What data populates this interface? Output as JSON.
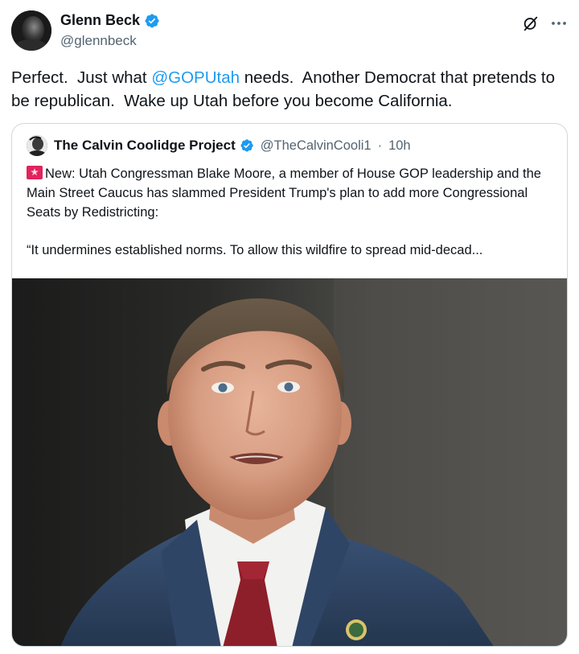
{
  "tweet": {
    "author": {
      "name": "Glenn Beck",
      "handle": "@glennbeck",
      "verified": true
    },
    "text_before": "Perfect.  Just what ",
    "mention": "@GOPUtah",
    "text_after": " needs.  Another Democrat that pretends to be republican.  Wake up Utah before you become California.",
    "actions": {
      "grok_icon": "grok-icon",
      "more_icon": "more-icon"
    }
  },
  "quote": {
    "author": {
      "name": "The Calvin Coolidge Project",
      "handle": "@TheCalvinCooli1",
      "separator": "·",
      "time": "10h",
      "verified": true
    },
    "paragraph1": "New: Utah Congressman Blake Moore, a member of House GOP leadership and the Main Street Caucus has slammed President Trump's plan to add more Congressional Seats by Redistricting:",
    "paragraph2": "“It undermines established norms. To allow this wildfire to spread mid-decad...",
    "icon": "rotating-light-emoji",
    "media": "photo"
  },
  "colors": {
    "text": "#0f1419",
    "secondary": "#536471",
    "link": "#1d9bf0",
    "verified": "#1d9bf0",
    "border": "#cfd9de"
  }
}
